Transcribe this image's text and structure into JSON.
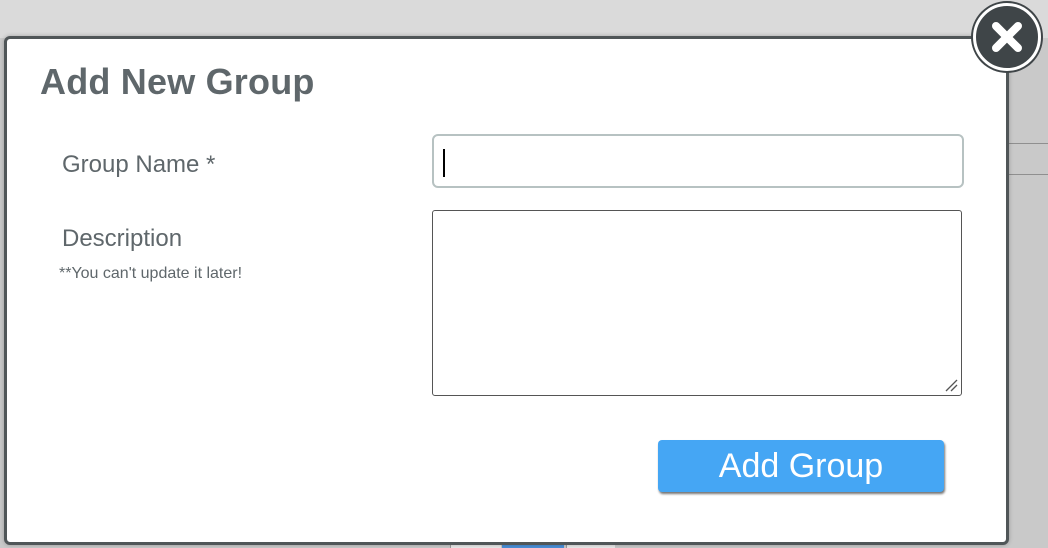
{
  "modal": {
    "title": "Add New Group",
    "fields": {
      "group_name": {
        "label": "Group Name *",
        "value": "",
        "placeholder": ""
      },
      "description": {
        "label": "Description",
        "hint": "**You can't update it later!",
        "value": "",
        "placeholder": ""
      }
    },
    "submit_label": "Add Group",
    "close_icon": "close-icon"
  },
  "colors": {
    "title_text": "#5f676b",
    "button_bg": "#45a6f4",
    "button_text": "#ffffff",
    "modal_border": "#505658",
    "close_bg": "#3f4548"
  }
}
